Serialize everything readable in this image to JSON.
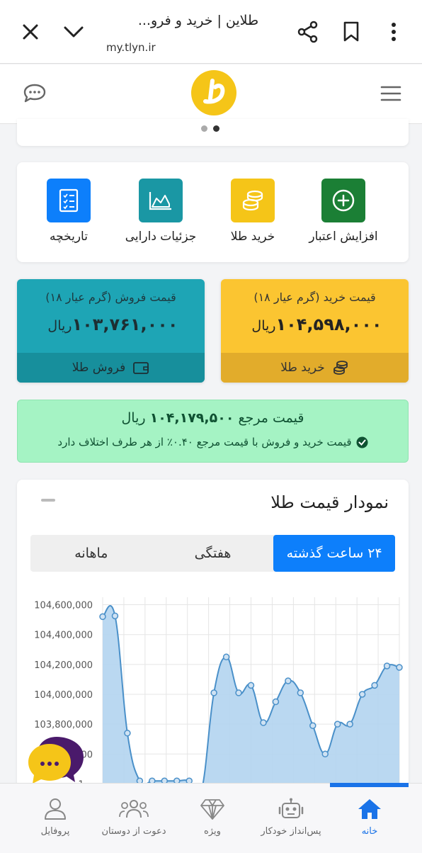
{
  "browser": {
    "title": "طلاین | خرید و فرو...",
    "url": "my.tlyn.ir"
  },
  "actions": [
    {
      "label": "افزایش اعتبار",
      "icon": "plus-circle-icon",
      "color": "#1b7f35"
    },
    {
      "label": "خرید طلا",
      "icon": "coins-icon",
      "color": "#f5c518"
    },
    {
      "label": "جزئیات دارایی",
      "icon": "area-chart-icon",
      "color": "#1a97a4"
    },
    {
      "label": "تاریخچه",
      "icon": "checklist-icon",
      "color": "#0d7ffb"
    }
  ],
  "buy": {
    "title": "قیمت خرید (گرم عیار ۱۸)",
    "value": "۱۰۴,۵۹۸,۰۰۰",
    "unit": "ریال",
    "button": "خرید طلا"
  },
  "sell": {
    "title": "قیمت فروش (گرم عیار ۱۸)",
    "value": "۱۰۳,۷۶۱,۰۰۰",
    "unit": "ریال",
    "button": "فروش طلا"
  },
  "reference": {
    "label": "قیمت مرجع",
    "value": "۱۰۴,۱۷۹,۵۰۰",
    "unit": "ریال",
    "note": "قیمت خرید و فروش با قیمت مرجع ۰.۴۰٪ از هر طرف اختلاف دارد"
  },
  "chart_section": {
    "title": "نمودار قیمت طلا",
    "tabs": [
      "۲۴ ساعت گذشته",
      "هفتگی",
      "ماهانه"
    ],
    "active_tab": 0
  },
  "chart_data": {
    "type": "area",
    "ylim": [
      103350000,
      104650000
    ],
    "yticks": [
      104600000,
      104400000,
      104200000,
      104000000,
      103800000,
      103600000,
      103400000
    ],
    "ytick_labels": [
      "104,600,000",
      "104,400,000",
      "104,200,000",
      "104,000,000",
      "103,800,000",
      "103,600,000",
      "1..."
    ],
    "values": [
      104520000,
      104525000,
      103740000,
      103420000,
      103420000,
      103420000,
      103420000,
      103420000,
      103360000,
      104010000,
      104250000,
      104010000,
      104060000,
      103810000,
      103950000,
      104090000,
      104010000,
      103790000,
      103600000,
      103800000,
      103800000,
      104000000,
      104060000,
      104190000,
      104180000
    ],
    "colors": {
      "fill": "#b3d4ef",
      "line": "#4a90c9",
      "grid": "#e5e5e5"
    }
  },
  "bottom_nav": [
    {
      "label": "خانه",
      "icon": "home-icon",
      "active": true
    },
    {
      "label": "پس‌انداز خودکار",
      "icon": "robot-icon",
      "active": false
    },
    {
      "label": "ویژه",
      "icon": "diamond-icon",
      "active": false
    },
    {
      "label": "دعوت از دوستان",
      "icon": "users-icon",
      "active": false
    },
    {
      "label": "پروفایل",
      "icon": "user-icon",
      "active": false
    }
  ]
}
